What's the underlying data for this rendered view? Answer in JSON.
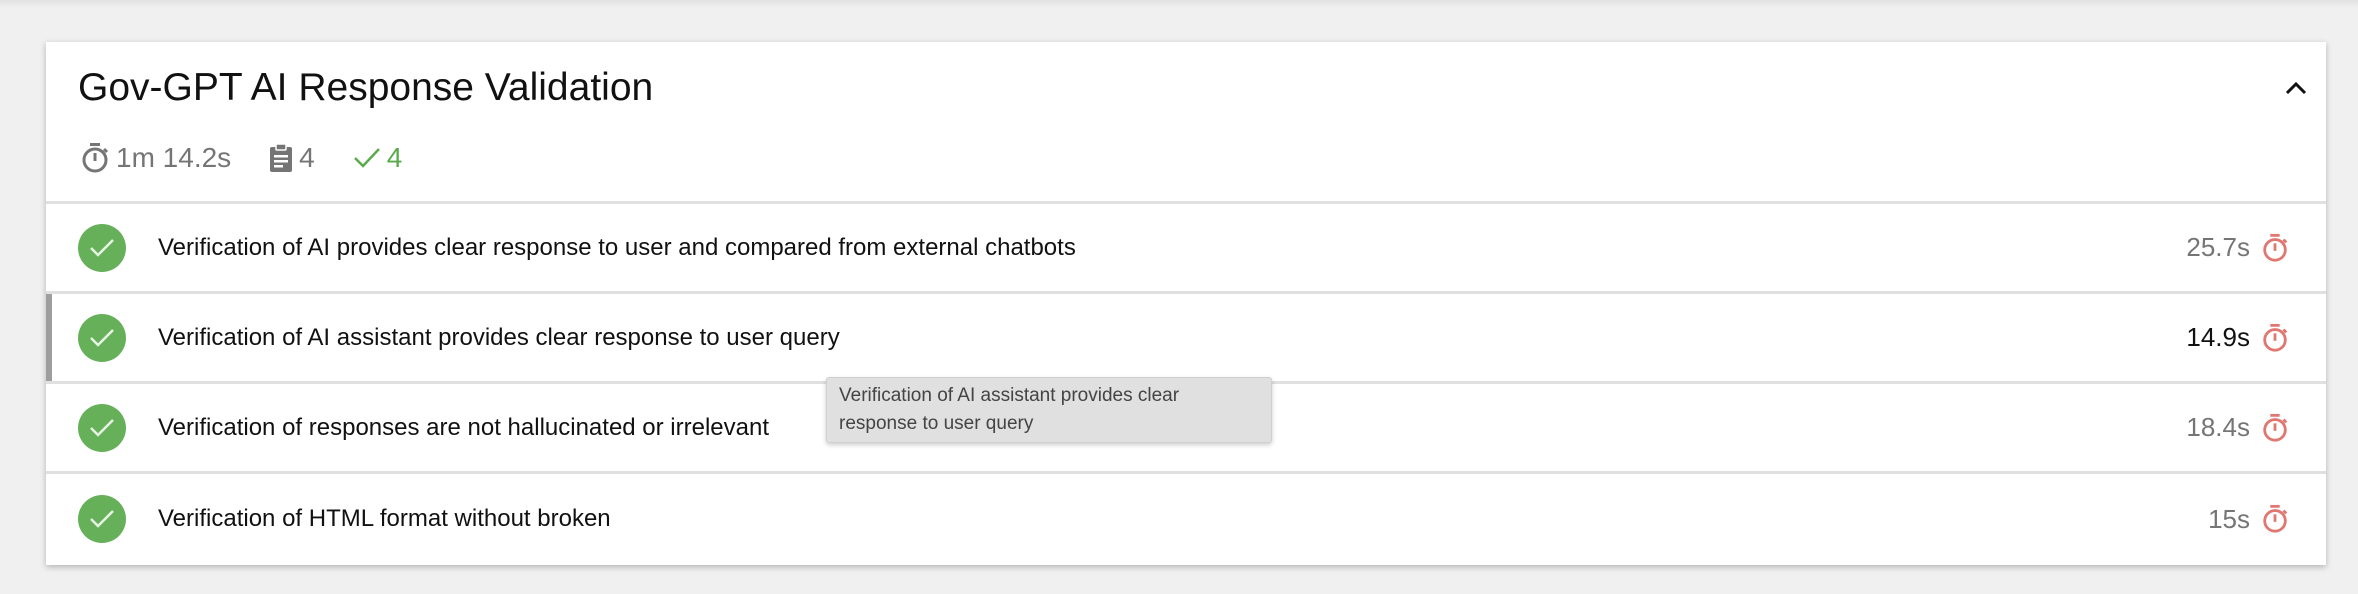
{
  "suite": {
    "title": "Gov-GPT AI Response Validation",
    "duration": "1m 14.2s",
    "total_tests": "4",
    "passed_tests": "4",
    "collapse_icon": "chevron-up-icon"
  },
  "tests": [
    {
      "label": "Verification of AI provides clear response to user and compared from external chatbots",
      "duration": "25.7s",
      "status": "passed"
    },
    {
      "label": "Verification of AI assistant provides clear response to user query",
      "duration": "14.9s",
      "status": "passed"
    },
    {
      "label": "Verification of responses are not hallucinated or irrelevant",
      "duration": "18.4s",
      "status": "passed"
    },
    {
      "label": "Verification of HTML format without broken",
      "duration": "15s",
      "status": "passed"
    }
  ],
  "tooltip": {
    "text": "Verification of AI assistant provides clear response to user query"
  },
  "colors": {
    "passed": "#66b05a",
    "timer": "#e07770",
    "hover_bar": "#9e9e9e"
  }
}
